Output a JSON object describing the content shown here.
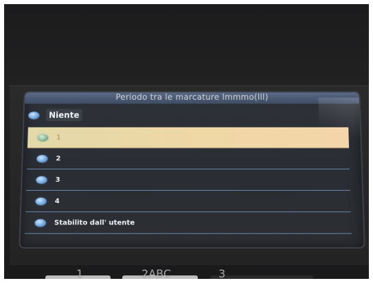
{
  "screen": {
    "title": "Periodo tra le marcature lmmmo(lll)",
    "header": {
      "label": "Niente"
    },
    "options": [
      {
        "label": "1",
        "selected": true
      },
      {
        "label": "2",
        "selected": false
      },
      {
        "label": "3",
        "selected": false
      },
      {
        "label": "4",
        "selected": false
      },
      {
        "label": "Stabilito dall' utente",
        "selected": false
      }
    ]
  },
  "keypad": {
    "keys": [
      "1",
      "2ABC",
      "3"
    ]
  },
  "colors": {
    "highlight": "#efd8a8",
    "divider": "#6d86aa",
    "radio": "#7fb2e6"
  }
}
